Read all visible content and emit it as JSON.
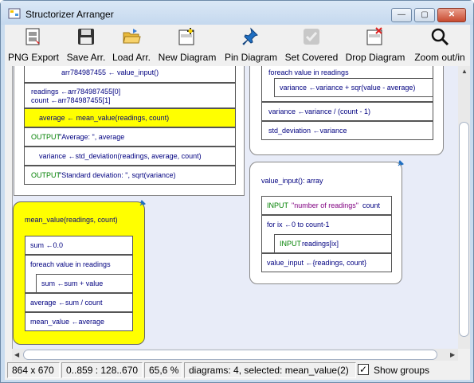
{
  "window": {
    "title": "Structorizer Arranger",
    "controls": {
      "minimize": "—",
      "maximize": "▢",
      "close": "✕"
    }
  },
  "toolbar": {
    "items": [
      {
        "label": "PNG Export",
        "icon": "png-export-icon"
      },
      {
        "label": "Save Arr.",
        "icon": "floppy-disk-icon"
      },
      {
        "label": "Load Arr.",
        "icon": "open-folder-icon"
      },
      {
        "label": "New Diagram",
        "icon": "new-diagram-icon"
      },
      {
        "label": "Pin Diagram",
        "icon": "pushpin-icon"
      },
      {
        "label": "Set Covered",
        "icon": "checkmark-icon",
        "disabled": true
      },
      {
        "label": "Drop Diagram",
        "icon": "drop-diagram-icon"
      },
      {
        "label": "Zoom out/in",
        "icon": "magnifier-icon"
      }
    ]
  },
  "diagrams": {
    "main": {
      "rows": [
        "arr784987455 ← value_input()",
        "readings ←arr784987455[0]",
        "count ←arr784987455[1]",
        "average ← mean_value(readings, count)",
        "OUTPUT",
        "\"Average: \", average",
        "variance ←std_deviation(readings, average, count)",
        "OUTPUT",
        "\"Standard deviation: \", sqrt(variance)"
      ]
    },
    "std_dev": {
      "rows": [
        "foreach value in readings",
        "variance ←variance + sqr(value - average)",
        "variance ←variance / (count - 1)",
        "std_deviation ←variance"
      ]
    },
    "value_input": {
      "header": "value_input(): array",
      "rows": [
        "INPUT",
        "\"number of readings\"",
        "count",
        "for ix ←0 to count-1",
        "INPUT",
        "readings[ix]",
        "value_input ←{readings, count}"
      ]
    },
    "mean_value": {
      "header": "mean_value(readings, count)",
      "rows": [
        "sum ←0.0",
        "foreach value in readings",
        "sum ←sum + value",
        "average ←sum / count",
        "mean_value ←average"
      ]
    }
  },
  "status": {
    "size": "864 x 670",
    "range": "0..859 : 128..670",
    "zoom": "65,6 %",
    "info": "diagrams: 4, selected: mean_value(2)",
    "show_groups_label": "Show groups",
    "show_groups_checked": "✓"
  },
  "colors": {
    "selected_diagram": "#ffff00",
    "keyword": "#000080",
    "output_keyword": "#008000",
    "string": "#800080",
    "canvas": "#e8ecf8"
  }
}
